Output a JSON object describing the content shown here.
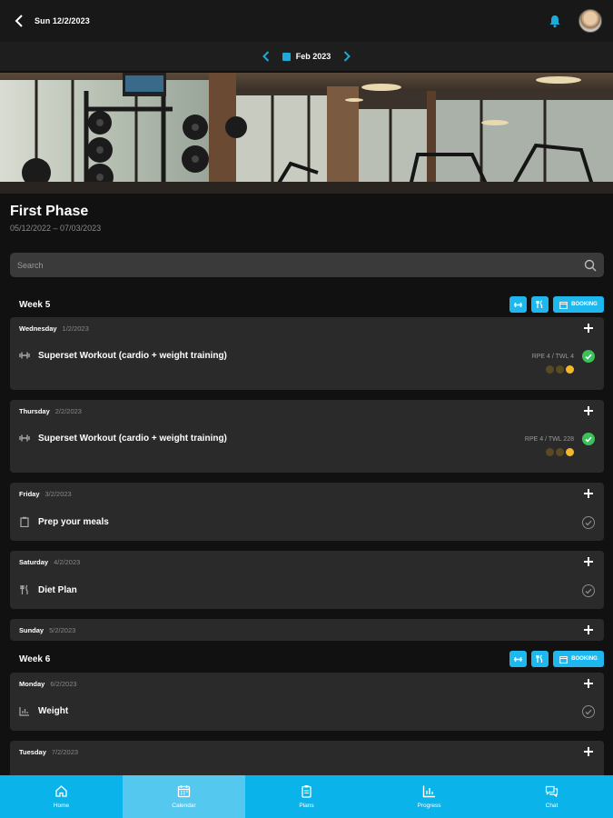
{
  "header": {
    "date": "Sun 12/2/2023"
  },
  "month_nav": {
    "month": "Feb 2023"
  },
  "phase": {
    "title": "First Phase",
    "range": "05/12/2022 – 07/03/2023"
  },
  "search": {
    "placeholder": "Search"
  },
  "weeks": [
    {
      "title": "Week 5",
      "booking_label": "BOOKING"
    },
    {
      "title": "Week 6",
      "booking_label": "BOOKING"
    }
  ],
  "days": [
    {
      "name": "Wednesday",
      "date": "1/2/2023",
      "item": "Superset Workout (cardio + weight training)",
      "item_icon": "dumbbell-icon",
      "rpe": "RPE 4 / TWL 4",
      "done": true
    },
    {
      "name": "Thursday",
      "date": "2/2/2023",
      "item": "Superset Workout (cardio + weight training)",
      "item_icon": "dumbbell-icon",
      "rpe": "RPE 4 / TWL 228",
      "done": true
    },
    {
      "name": "Friday",
      "date": "3/2/2023",
      "item": "Prep your meals",
      "item_icon": "clipboard-icon",
      "done": false
    },
    {
      "name": "Saturday",
      "date": "4/2/2023",
      "item": "Diet Plan",
      "item_icon": "cutlery-icon",
      "done": false
    },
    {
      "name": "Sunday",
      "date": "5/2/2023"
    },
    {
      "name": "Monday",
      "date": "6/2/2023",
      "item": "Weight",
      "item_icon": "bar-chart-icon",
      "done": false
    },
    {
      "name": "Tuesday",
      "date": "7/2/2023"
    }
  ],
  "bottom_nav": [
    {
      "label": "Home",
      "icon": "home-icon",
      "active": false
    },
    {
      "label": "Calendar",
      "icon": "calendar-icon",
      "active": true
    },
    {
      "label": "Plans",
      "icon": "clipboard-icon",
      "active": false
    },
    {
      "label": "Progress",
      "icon": "bar-chart-icon",
      "active": false
    },
    {
      "label": "Chat",
      "icon": "chat-icon",
      "active": false
    }
  ],
  "colors": {
    "accent": "#0ab4ea",
    "success": "#3bc15a",
    "card": "#2a2a2a",
    "background": "#111111"
  }
}
